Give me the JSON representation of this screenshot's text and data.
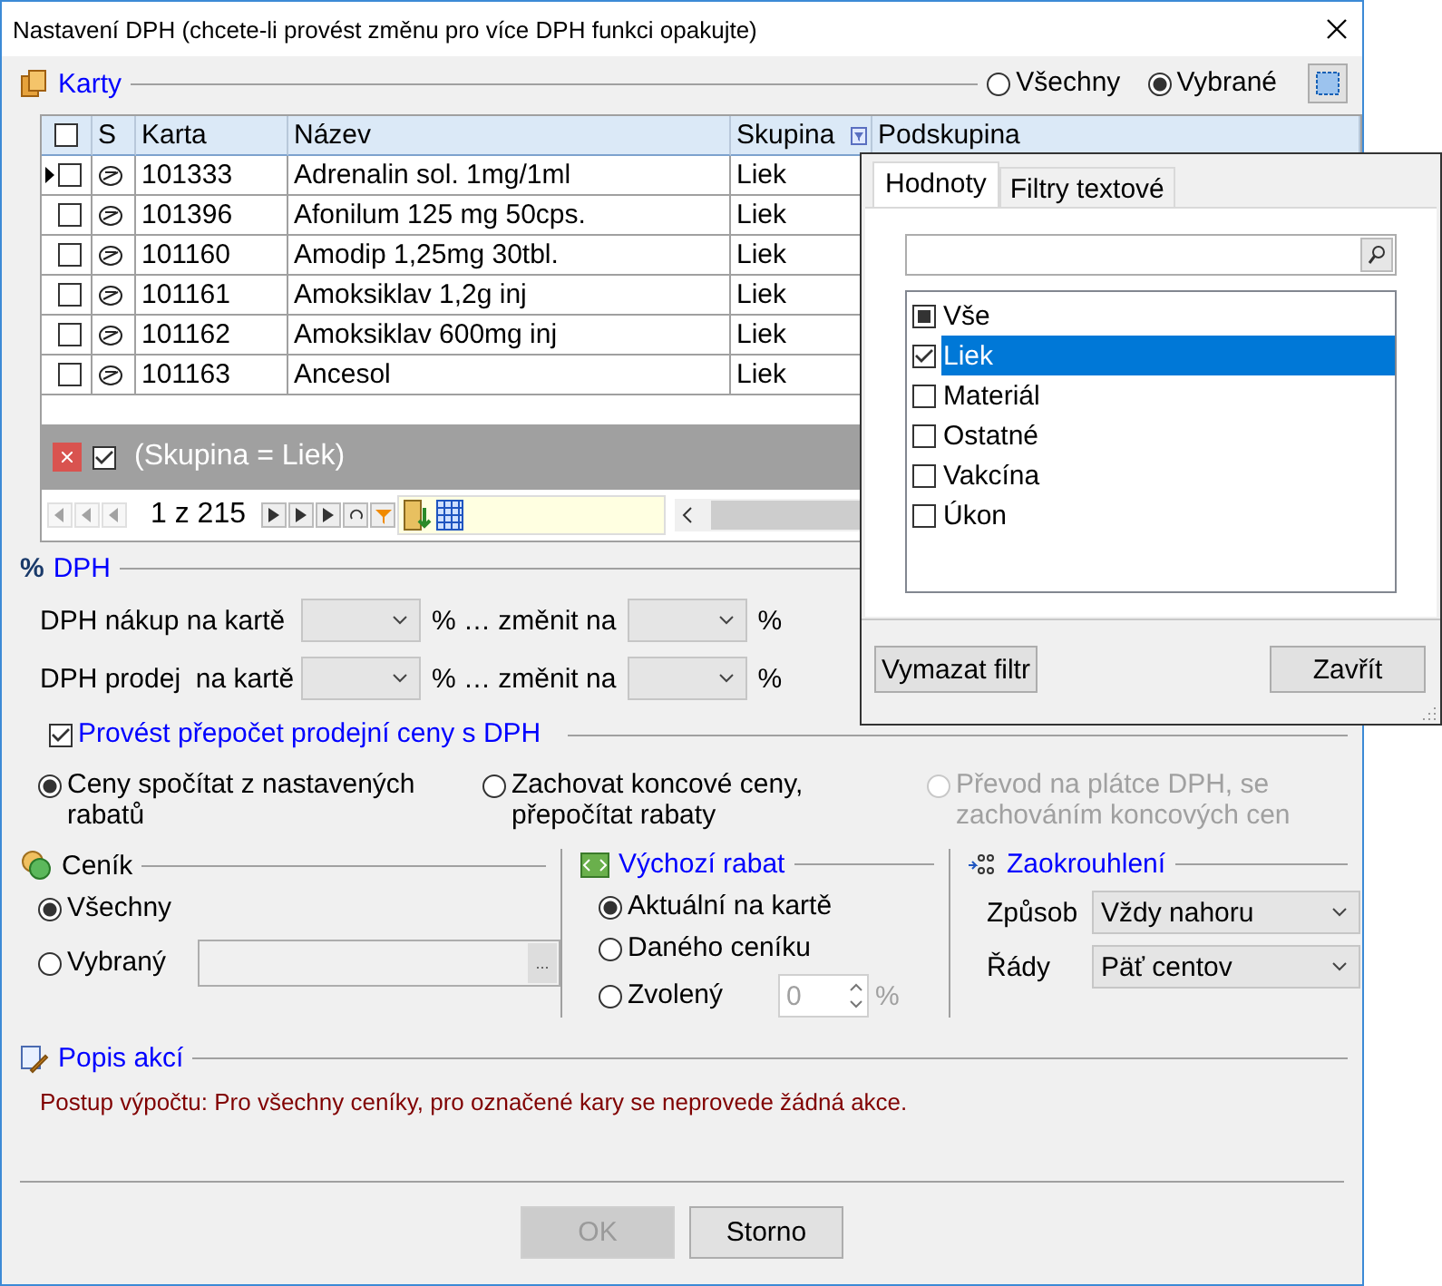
{
  "window": {
    "title": "Nastavení DPH (chcete-li provést změnu pro více DPH funkci opakujte)"
  },
  "cards": {
    "title": "Karty",
    "scope": [
      {
        "label": "Všechny",
        "selected": false
      },
      {
        "label": "Vybrané",
        "selected": true
      }
    ],
    "all_checked": false,
    "columns": [
      "S",
      "Karta",
      "Název",
      "Skupina",
      "Podskupina"
    ],
    "rows": [
      {
        "current": true,
        "checked": false,
        "card": "101333",
        "name": "Adrenalin sol. 1mg/1ml",
        "group": "Liek"
      },
      {
        "current": false,
        "checked": false,
        "card": "101396",
        "name": "Afonilum 125 mg 50cps.",
        "group": "Liek"
      },
      {
        "current": false,
        "checked": false,
        "card": "101160",
        "name": "Amodip 1,25mg 30tbl.",
        "group": "Liek"
      },
      {
        "current": false,
        "checked": false,
        "card": "101161",
        "name": "Amoksiklav 1,2g inj",
        "group": "Liek"
      },
      {
        "current": false,
        "checked": false,
        "card": "101162",
        "name": "Amoksiklav 600mg inj",
        "group": "Liek"
      },
      {
        "current": false,
        "checked": false,
        "card": "101163",
        "name": "Ancesol",
        "group": "Liek"
      }
    ],
    "filter": {
      "checked": true,
      "text": "(Skupina = Liek)"
    },
    "pager": "1 z 215"
  },
  "filter_popup": {
    "tabs": [
      {
        "label": "Hodnoty",
        "selected": true
      },
      {
        "label": "Filtry textové",
        "selected": false
      }
    ],
    "select_all": {
      "label": "Vše",
      "partial": true
    },
    "items": [
      {
        "label": "Liek",
        "checked": true,
        "selected": true
      },
      {
        "label": "Materiál",
        "checked": false,
        "selected": false
      },
      {
        "label": "Ostatné",
        "checked": false,
        "selected": false
      },
      {
        "label": "Vakcína",
        "checked": false,
        "selected": false
      },
      {
        "label": "Úkon",
        "checked": false,
        "selected": false
      }
    ],
    "buttons": [
      "Vymazat filtr",
      "Zavřít"
    ]
  },
  "vat": {
    "title": "DPH",
    "title_mark": "%",
    "rows": [
      {
        "label": "DPH nákup na kartě",
        "mid": "% … změnit na",
        "unit": "%"
      },
      {
        "label": "DPH prodej  na kartě",
        "mid": "% … změnit na",
        "unit": "%"
      }
    ]
  },
  "recalc": {
    "label": "Provést přepočet prodejní ceny s DPH",
    "checked": true,
    "options": [
      {
        "label": "Ceny spočítat z nastavených rabatů",
        "selected": true,
        "disabled": false
      },
      {
        "label": "Zachovat koncové ceny, přepočítat rabaty",
        "selected": false,
        "disabled": false
      },
      {
        "label": "Převod na plátce DPH, se zachováním koncových cen",
        "selected": false,
        "disabled": true
      }
    ]
  },
  "pricelist": {
    "title": "Ceník",
    "options": [
      {
        "label": "Všechny",
        "selected": true
      },
      {
        "label": "Vybraný",
        "selected": false
      }
    ],
    "browse": "..."
  },
  "discount": {
    "title": "Výchozí rabat",
    "options": [
      {
        "label": "Aktuální na kartě",
        "selected": true
      },
      {
        "label": "Daného ceníku",
        "selected": false
      },
      {
        "label": "Zvolený",
        "selected": false
      }
    ],
    "value": "0",
    "unit": "%"
  },
  "rounding": {
    "title": "Zaokrouhlení",
    "fields": [
      {
        "label": "Způsob",
        "value": "Vždy nahoru"
      },
      {
        "label": "Řády",
        "value": "Päť centov"
      }
    ]
  },
  "description": {
    "title": "Popis akcí",
    "text": "Postup výpočtu: Pro všechny ceníky, pro označené kary se neprovede žádná akce."
  },
  "buttons": [
    {
      "label": "OK",
      "disabled": true
    },
    {
      "label": "Storno",
      "disabled": false
    }
  ]
}
